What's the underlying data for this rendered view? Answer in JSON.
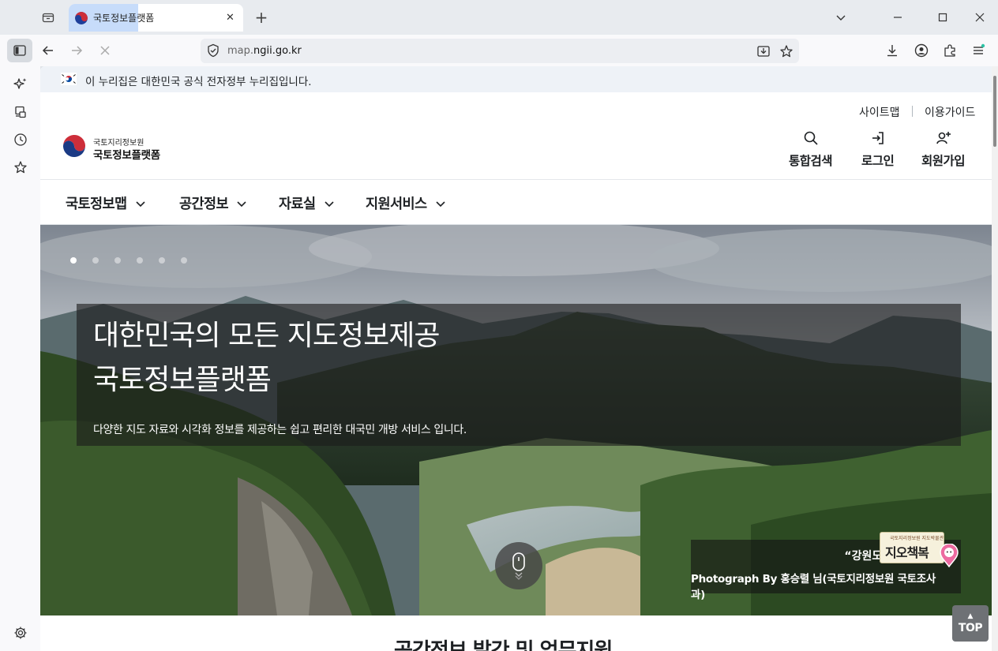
{
  "browser": {
    "tab_title": "국토정보플랫폼",
    "url_host": "map.",
    "url_domain": "ngii.go.kr",
    "new_tab_label": "+",
    "close_label": "✕"
  },
  "gov_banner": {
    "text": "이 누리집은 대한민국 공식 전자정부 누리집입니다."
  },
  "header": {
    "util_links": [
      "사이트맵",
      "이용가이드"
    ],
    "logo_org": "국토지리정보원",
    "logo_name": "국토정보플랫폼",
    "actions": [
      {
        "label": "통합검색",
        "icon": "search-icon"
      },
      {
        "label": "로그인",
        "icon": "login-icon"
      },
      {
        "label": "회원가입",
        "icon": "signup-icon"
      }
    ]
  },
  "gnb": {
    "items": [
      "국토정보맵",
      "공간정보",
      "자료실",
      "지원서비스"
    ]
  },
  "hero": {
    "title_line1": "대한민국의 모든 지도정보제공",
    "title_line2": "국토정보플랫폼",
    "subtitle": "다양한 지도 자료와 시각화 정보를 제공하는 쉽고 편리한 대국민 개방 서비스 입니다.",
    "slide_count": 6,
    "active_slide": 1,
    "photo_quote": "“강원도 영",
    "photo_credit": "Photograph By 홍승렬 님(국토지리정보원 국토조사과)",
    "badge_small": "국토지리정보원 지도박물관",
    "badge_text": "지오책복"
  },
  "section": {
    "title": "공간정보 발간 및 업무지원"
  },
  "top_button": {
    "arrow": "▲",
    "label": "TOP"
  },
  "colors": {
    "banner_bg": "#eef2f7",
    "text": "#1e2124",
    "tab_highlight": "#c7dcfa"
  }
}
